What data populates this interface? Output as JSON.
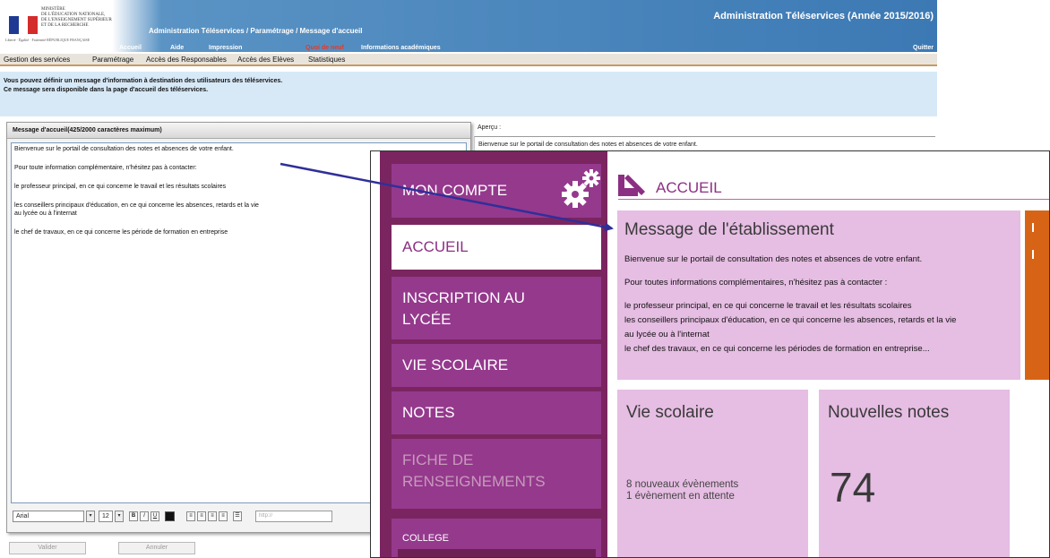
{
  "header": {
    "logo_lines": "MINISTÈRE\nDE L'ÉDUCATION NATIONALE,\nDE L'ENSEIGNEMENT SUPÉRIEUR\nET DE LA RECHERCHE",
    "logo_motto": "Liberté · Égalité · Fraternité  RÉPUBLIQUE FRANÇAISE",
    "breadcrumb": "Administration Téléservices / Paramétrage / Message d'accueil",
    "title": "Administration Téléservices (Année 2015/2016)",
    "menu": {
      "accueil": "Accueil",
      "aide": "Aide",
      "impression": "Impression",
      "quoi_de_neuf": "Quoi de neuf",
      "informations": "Informations académiques",
      "quitter": "Quitter"
    }
  },
  "menubar": [
    "Gestion des services",
    "Paramétrage",
    "Accès des Responsables",
    "Accès des Elèves",
    "Statistiques"
  ],
  "info": {
    "line1": "Vous pouvez définir un message d'information à destination des utilisateurs des téléservices.",
    "line2": "Ce message sera disponible dans la page d'accueil des téléservices."
  },
  "editor": {
    "title": "Message d'accueil(425/2000 caractères maximum)",
    "paragraphs": [
      "Bienvenue sur le portail de consultation des notes et absences de votre enfant.",
      "Pour toute information complémentaire, n'hésitez pas à contacter:",
      "le professeur principal, en ce qui concerne le travail et les résultats scolaires",
      "les conseillers principaux d'éducation, en ce qui concerne les absences, retards et la vie\nau lycée ou à l'internat",
      "le chef de travaux, en ce qui concerne les période de formation en entreprise"
    ],
    "font": "Arial",
    "size": "12",
    "url_placeholder": "http://",
    "validate": "Valider",
    "cancel": "Annuler"
  },
  "preview": {
    "label": "Aperçu :",
    "text": "Bienvenue sur le portail de consultation des notes et absences de votre enfant."
  },
  "portal": {
    "nav": {
      "mon_compte": "MON COMPTE",
      "accueil": "ACCUEIL",
      "inscription": "INSCRIPTION AU\nLYCÉE",
      "vie_scolaire": "VIE SCOLAIRE",
      "notes": "NOTES",
      "fiche": "FICHE DE\nRENSEIGNEMENTS",
      "college": "COLLEGE"
    },
    "page_title": "ACCUEIL",
    "message": {
      "title": "Message de l'établissement",
      "lines": [
        "Bienvenue sur le portail de consultation des notes et absences de votre enfant.",
        "Pour toutes informations complémentaires, n'hésitez pas à contacter :",
        "le professeur principal, en ce qui concerne le travail et les résultats scolaires",
        "les conseillers principaux d'éducation, en ce qui concerne les absences, retards et la vie",
        "au lycée ou à l'internat",
        "le chef des travaux, en ce qui concerne les périodes de formation en entreprise..."
      ]
    },
    "vie_scolaire": {
      "title": "Vie scolaire",
      "line1": "8 nouveaux évènements",
      "line2": "1 évènement en attente"
    },
    "notes": {
      "title": "Nouvelles notes",
      "count": "74"
    }
  },
  "colors": {
    "header_blue": "#3c79b4",
    "info_bg": "#d7e9f7",
    "nav_purple": "#95398d",
    "nav_dark": "#7a2560",
    "card_pink": "#e6bde3",
    "accent_orange": "#d76416",
    "arrow_blue": "#2f2f9a"
  }
}
